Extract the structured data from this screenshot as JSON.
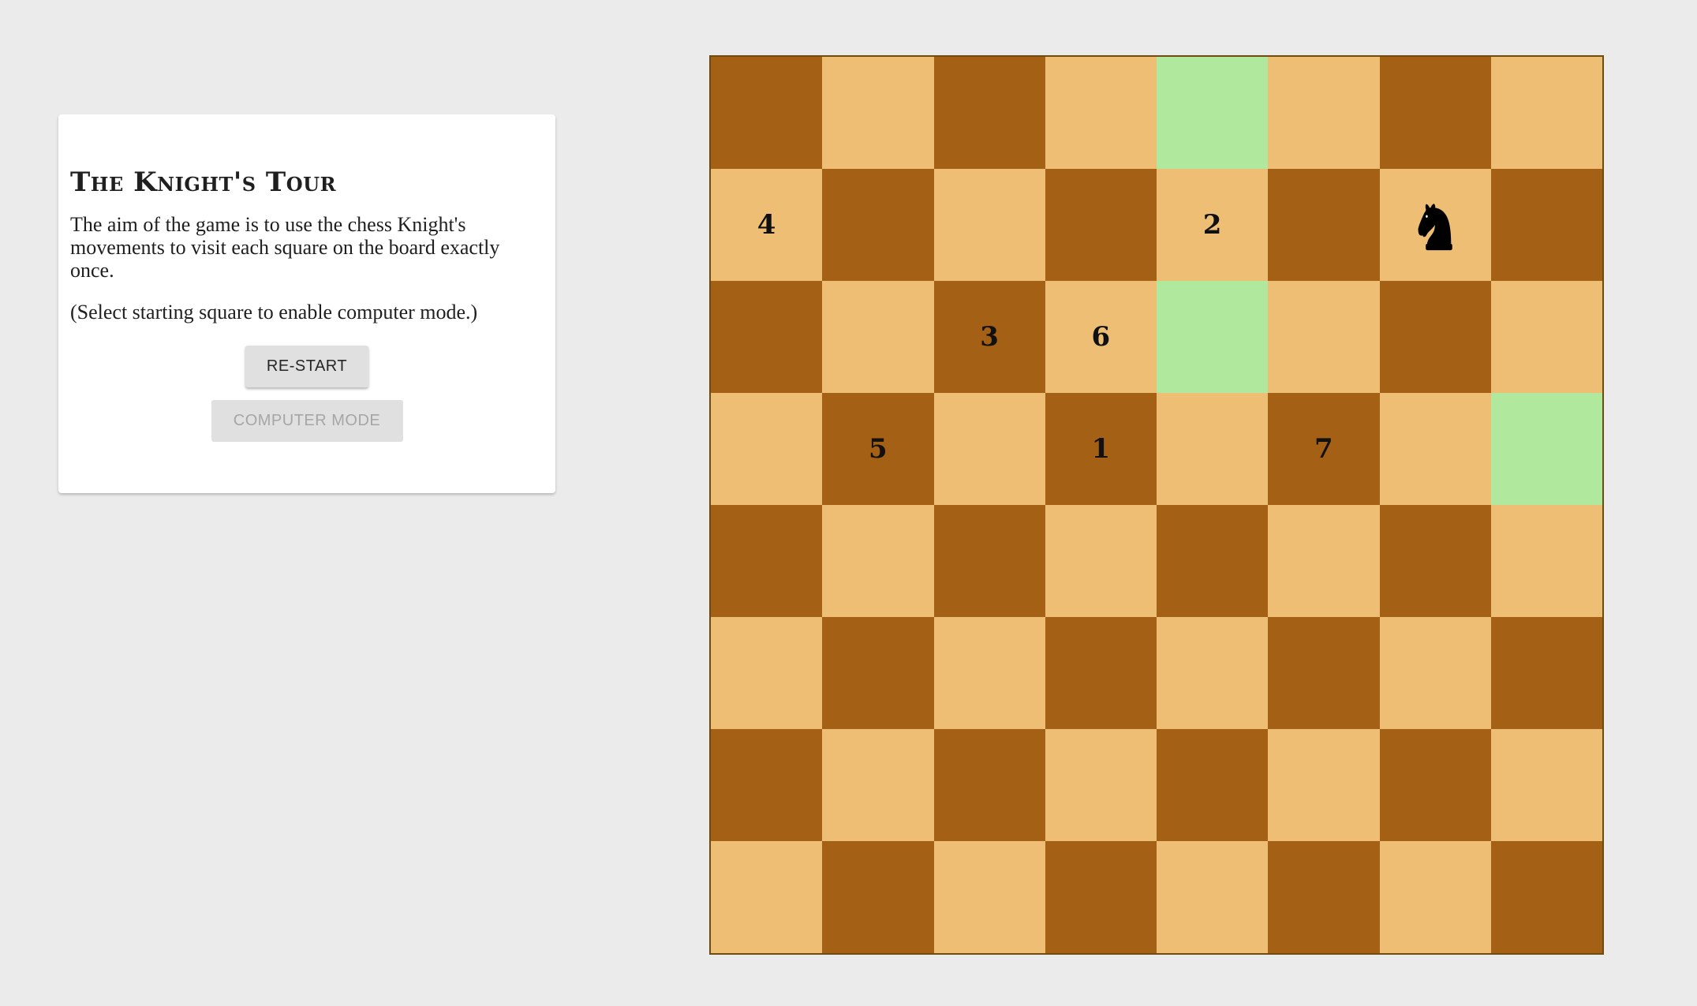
{
  "info": {
    "title": "The Knight's Tour",
    "description": "The aim of the game is to use the chess Knight's movements to visit each square on the board exactly once.",
    "hint": "(Select starting square to enable computer mode.)",
    "restart_label": "RE-START",
    "computer_mode_label": "COMPUTER MODE"
  },
  "colors": {
    "light_square": "#eebe74",
    "dark_square": "#a46014",
    "possible_move": "#b0e89d",
    "page_background": "#ebebeb"
  },
  "board": {
    "size": 8,
    "knight": {
      "row": 1,
      "col": 6,
      "icon": "knight-icon"
    },
    "visited": [
      {
        "row": 3,
        "col": 3,
        "label": "1"
      },
      {
        "row": 1,
        "col": 4,
        "label": "2"
      },
      {
        "row": 2,
        "col": 2,
        "label": "3"
      },
      {
        "row": 1,
        "col": 0,
        "label": "4"
      },
      {
        "row": 3,
        "col": 1,
        "label": "5"
      },
      {
        "row": 2,
        "col": 3,
        "label": "6"
      },
      {
        "row": 3,
        "col": 5,
        "label": "7"
      }
    ],
    "possible_moves": [
      {
        "row": 0,
        "col": 4
      },
      {
        "row": 2,
        "col": 4
      },
      {
        "row": 3,
        "col": 7
      }
    ]
  }
}
